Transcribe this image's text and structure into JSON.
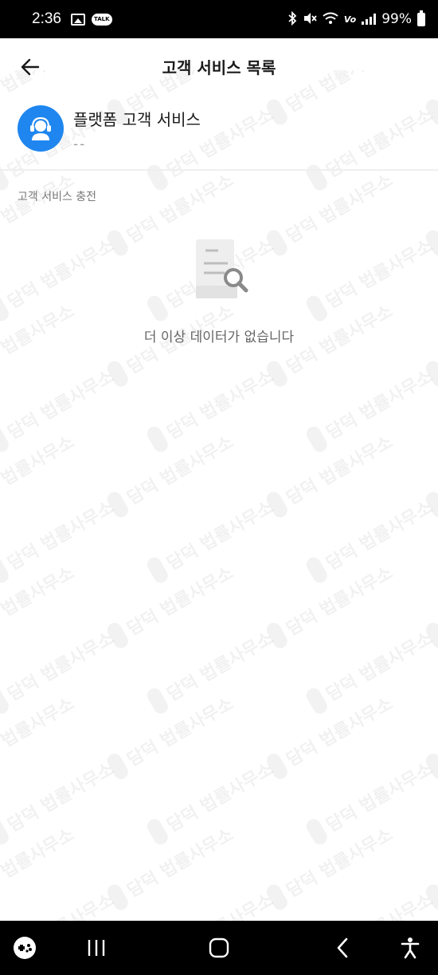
{
  "status_bar": {
    "time": "2:36",
    "battery_percent": "99%",
    "icons": [
      "gallery-icon",
      "kakaotalk-icon",
      "bluetooth-icon",
      "mute-icon",
      "wifi-icon",
      "volte-icon",
      "signal-icon",
      "battery-icon"
    ],
    "talk_badge": "TALK",
    "volte_label": "Vo"
  },
  "header": {
    "title": "고객 서비스 목록",
    "back_icon": "arrow-left-icon"
  },
  "service_item": {
    "name": "플랫폼 고객 서비스",
    "subtitle": "--",
    "avatar_icon": "headset-agent-icon",
    "avatar_color": "#1f86f0"
  },
  "section": {
    "label": "고객 서비스 충전"
  },
  "empty_state": {
    "icon": "document-search-icon",
    "message": "더 이상 데이터가 없습니다"
  },
  "watermark": {
    "text": "담덕 법률사무소"
  },
  "nav_bar": {
    "buttons": [
      "game-launcher-icon",
      "recent-apps-icon",
      "home-icon",
      "back-icon",
      "accessibility-icon"
    ]
  }
}
